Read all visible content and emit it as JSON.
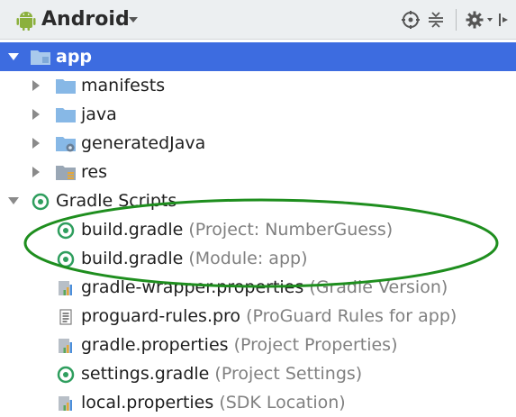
{
  "toolbar": {
    "view_selector": "Android",
    "icons": [
      "android-icon",
      "target-icon",
      "collapse-icon",
      "gear-icon",
      "pin-icon"
    ]
  },
  "tree": {
    "app": "app",
    "manifests": "manifests",
    "java": "java",
    "generated_java": "generatedJava",
    "res": "res",
    "gradle_scripts": "Gradle Scripts",
    "files": [
      {
        "name": "build.gradle",
        "hint": "(Project: NumberGuess)"
      },
      {
        "name": "build.gradle",
        "hint": "(Module: app)"
      },
      {
        "name": "gradle-wrapper.properties",
        "hint": "(Gradle Version)"
      },
      {
        "name": "proguard-rules.pro",
        "hint": "(ProGuard Rules for app)"
      },
      {
        "name": "gradle.properties",
        "hint": "(Project Properties)"
      },
      {
        "name": "settings.gradle",
        "hint": "(Project Settings)"
      },
      {
        "name": "local.properties",
        "hint": "(SDK Location)"
      }
    ]
  },
  "colors": {
    "selection": "#3d6ce0",
    "folder": "#87b8e6",
    "gradle": "#2f9e5e",
    "annotation_ellipse": "#1e8e1e"
  }
}
